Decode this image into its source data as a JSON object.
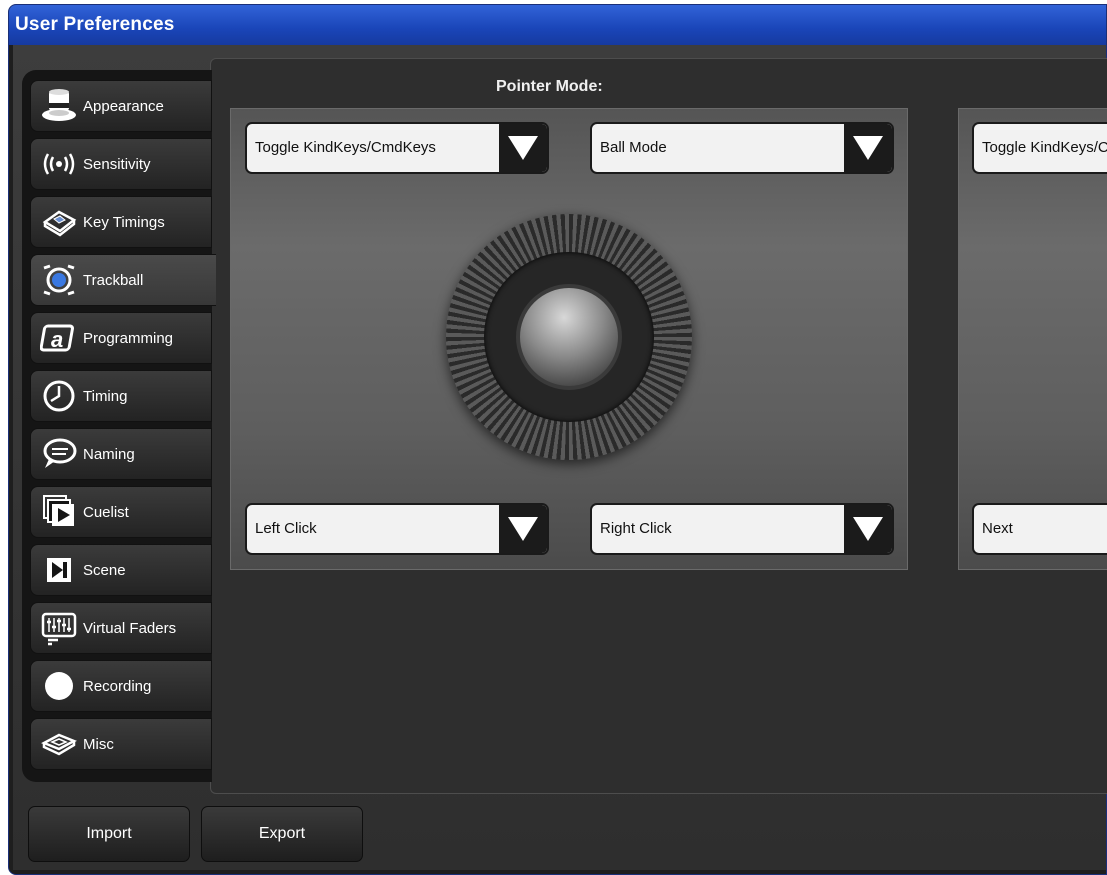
{
  "window": {
    "title": "User Preferences"
  },
  "sidebar": {
    "items": [
      {
        "label": "Appearance",
        "icon": "top-hat-icon"
      },
      {
        "label": "Sensitivity",
        "icon": "sensitivity-waves-icon"
      },
      {
        "label": "Key Timings",
        "icon": "key-icon"
      },
      {
        "label": "Trackball",
        "icon": "trackball-icon"
      },
      {
        "label": "Programming",
        "icon": "at-sign-icon"
      },
      {
        "label": "Timing",
        "icon": "clock-icon"
      },
      {
        "label": "Naming",
        "icon": "speech-bubble-icon"
      },
      {
        "label": "Cuelist",
        "icon": "cuelist-stack-icon"
      },
      {
        "label": "Scene",
        "icon": "scene-icon"
      },
      {
        "label": "Virtual Faders",
        "icon": "faders-icon"
      },
      {
        "label": "Recording",
        "icon": "record-dot-icon"
      },
      {
        "label": "Misc",
        "icon": "misc-key-icon"
      }
    ],
    "active": "Trackball"
  },
  "main": {
    "pointer_mode_title": "Pointer Mode:",
    "left_panel": {
      "top_left": "Toggle KindKeys/CmdKeys",
      "top_right": "Ball Mode",
      "bottom_left": "Left Click",
      "bottom_right": "Right Click"
    },
    "right_panel": {
      "top_left": "Toggle KindKeys/CmdKeys",
      "bottom_left": "Next"
    }
  },
  "footer": {
    "import_label": "Import",
    "export_label": "Export"
  },
  "colors": {
    "title_bar": "#2a55c8",
    "panel_bg": "#2e2e2e",
    "dropdown_bg": "#f2f2f2"
  }
}
